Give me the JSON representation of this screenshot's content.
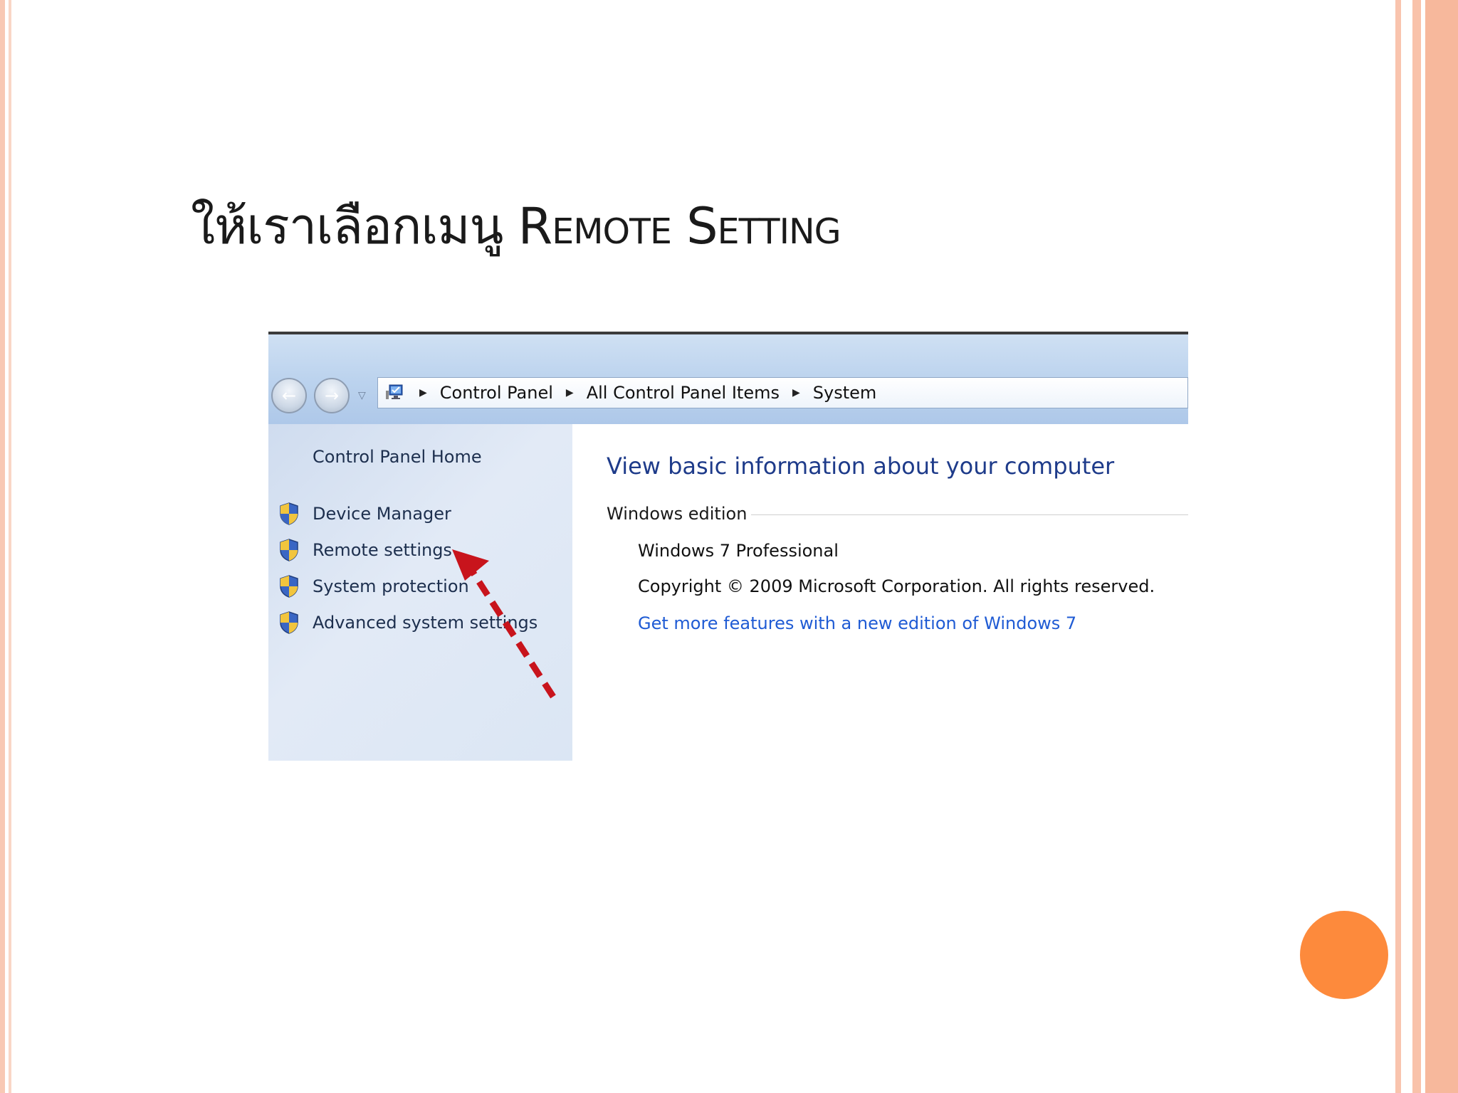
{
  "slide": {
    "title_thai": "ให้เราเลือกเมนู",
    "title_en": "Remote Setting",
    "colors": {
      "accent_border": "#f7b89c",
      "dot": "#fd8a3c"
    }
  },
  "toolbar": {
    "back_icon": "back-arrow-icon",
    "forward_icon": "forward-arrow-icon",
    "breadcrumb": [
      "Control Panel",
      "All Control Panel Items",
      "System"
    ]
  },
  "sidebar": {
    "home": "Control Panel Home",
    "items": [
      {
        "label": "Device Manager",
        "icon": "shield-icon"
      },
      {
        "label": "Remote settings",
        "icon": "shield-icon"
      },
      {
        "label": "System protection",
        "icon": "shield-icon"
      },
      {
        "label": "Advanced system settings",
        "icon": "shield-icon"
      }
    ]
  },
  "main": {
    "heading": "View basic information about your computer",
    "group_label": "Windows edition",
    "edition": "Windows 7 Professional",
    "copyright": "Copyright © 2009 Microsoft Corporation.  All rights reserved.",
    "more_features_link": "Get more features with a new edition of Windows 7",
    "colors": {
      "heading": "#1e3b8a",
      "link": "#1f5bd4"
    }
  },
  "annotation": {
    "arrow_color": "#c8141c",
    "arrow_style": "dashed"
  }
}
